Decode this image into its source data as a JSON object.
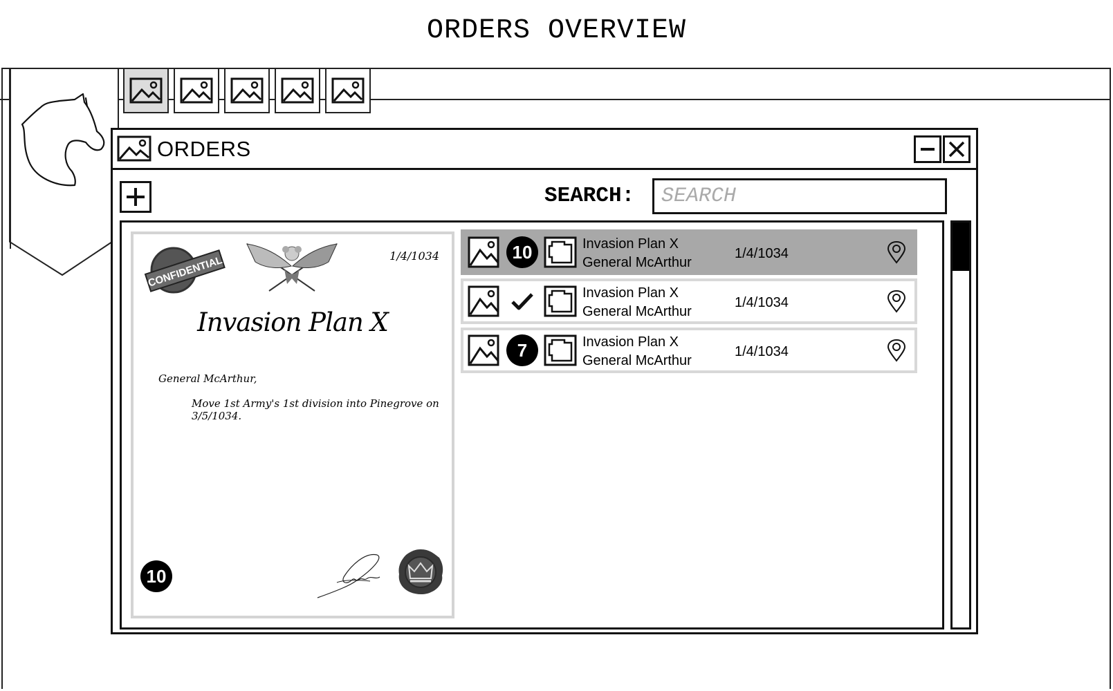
{
  "page": {
    "title": "ORDERS OVERVIEW"
  },
  "tabs": [
    {
      "icon": "image-icon",
      "active": true
    },
    {
      "icon": "image-icon",
      "active": false
    },
    {
      "icon": "image-icon",
      "active": false
    },
    {
      "icon": "image-icon",
      "active": false
    },
    {
      "icon": "image-icon",
      "active": false
    }
  ],
  "window": {
    "title": "ORDERS",
    "title_icon": "image-icon",
    "minimize_icon": "minimize-icon",
    "close_icon": "close-icon"
  },
  "toolbar": {
    "add_icon": "plus-icon",
    "search_label": "SEARCH:",
    "search_placeholder": "SEARCH",
    "search_value": ""
  },
  "document": {
    "date": "1/4/1034",
    "title": "Invasion Plan X",
    "salutation": "General McArthur,",
    "body": "Move 1st Army's 1st division into Pinegrove on 3/5/1034.",
    "stamp_text": "CONFIDENTIAL",
    "badge": "10"
  },
  "orders": [
    {
      "name": "Invasion Plan X",
      "general": "General McArthur",
      "date": "1/4/1034",
      "status": "10",
      "status_type": "badge",
      "selected": true
    },
    {
      "name": "Invasion Plan X",
      "general": "General McArthur",
      "date": "1/4/1034",
      "status": "",
      "status_type": "check",
      "selected": false
    },
    {
      "name": "Invasion Plan X",
      "general": "General McArthur",
      "date": "1/4/1034",
      "status": "7",
      "status_type": "badge",
      "selected": false
    }
  ],
  "colors": {
    "selected_row": "#a8a8a8",
    "border": "#111111",
    "row_border": "#d8d8d8"
  }
}
